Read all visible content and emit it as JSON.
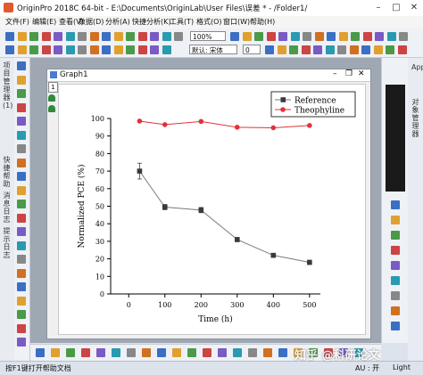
{
  "app": {
    "title": "OriginPro 2018C 64-bit - E:\\Documents\\OriginLab\\User Files\\误差 * - /Folder1/"
  },
  "menu": [
    "文件(F)",
    "编辑(E)",
    "查看(V)",
    "数据(D)",
    "分析(A)",
    "快捷分析(K)",
    "工具(T)",
    "格式(O)",
    "窗口(W)",
    "帮助(H)"
  ],
  "toolbar": {
    "zoom": "100%",
    "font": "默认: 宋体",
    "font_size": "0"
  },
  "left_tabs": [
    "项目管理器 (1)",
    "快捷帮助",
    "消息日志",
    "提示日志"
  ],
  "right_tabs": [
    "Apps",
    "对象管理器"
  ],
  "graph": {
    "title": "Graph1",
    "layer": "1"
  },
  "status": {
    "help": "按F1键打开帮助文档",
    "au": "AU : 开",
    "light": "Light"
  },
  "watermark": "知乎 @科研论文",
  "colors": {
    "reference": "#3a3a3a",
    "theophyline": "#e0333a",
    "errorbar": "#444444"
  },
  "chart_data": {
    "type": "line",
    "xlabel": "Time (h)",
    "ylabel": "Normalized PCE (%)",
    "xlim": [
      -50,
      530
    ],
    "ylim": [
      0,
      100
    ],
    "xticks": [
      0,
      100,
      200,
      300,
      400,
      500
    ],
    "yticks": [
      0,
      10,
      20,
      30,
      40,
      50,
      60,
      70,
      80,
      90,
      100
    ],
    "legend_position": "top-right",
    "series": [
      {
        "name": "Reference",
        "marker": "square",
        "x": [
          30,
          100,
          200,
          300,
          400,
          500
        ],
        "y": [
          70,
          49.5,
          47.8,
          31,
          22,
          18
        ],
        "error": [
          4.5,
          1.5,
          1.5,
          1.2,
          0.8,
          1.2
        ]
      },
      {
        "name": "Theophyline",
        "marker": "circle",
        "x": [
          30,
          100,
          200,
          300,
          400,
          500
        ],
        "y": [
          98.5,
          96.5,
          98.3,
          95,
          94.7,
          96
        ]
      }
    ]
  }
}
